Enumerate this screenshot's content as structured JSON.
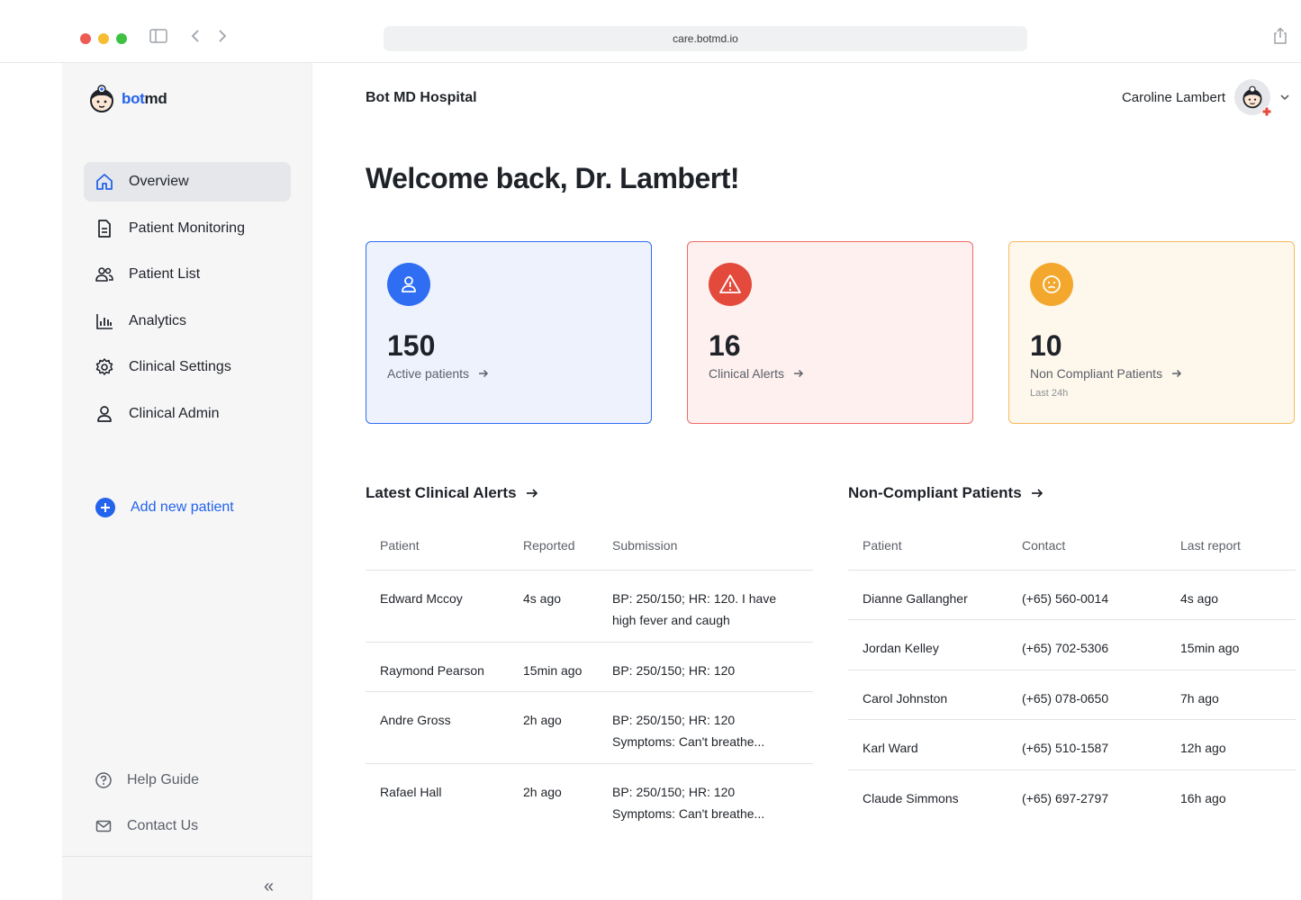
{
  "browser": {
    "url": "care.botmd.io"
  },
  "logo": {
    "part1": "bot",
    "part2": "md"
  },
  "sidebar": {
    "items": [
      {
        "label": "Overview",
        "icon": "home-icon",
        "active": true
      },
      {
        "label": "Patient Monitoring",
        "icon": "document-icon"
      },
      {
        "label": "Patient List",
        "icon": "users-icon"
      },
      {
        "label": "Analytics",
        "icon": "bar-chart-icon"
      },
      {
        "label": "Clinical Settings",
        "icon": "gear-icon"
      },
      {
        "label": "Clinical Admin",
        "icon": "user-icon"
      }
    ],
    "add_patient": "Add new patient",
    "help": "Help Guide",
    "contact": "Contact Us",
    "collapse": "«"
  },
  "header": {
    "hospital": "Bot MD Hospital",
    "user_name": "Caroline Lambert"
  },
  "welcome": "Welcome back, Dr. Lambert!",
  "cards": [
    {
      "value": "150",
      "label": "Active patients",
      "icon": "user-icon",
      "color": "#2f6ef3"
    },
    {
      "value": "16",
      "label": "Clinical Alerts",
      "icon": "warning-icon",
      "color": "#e34a3c"
    },
    {
      "value": "10",
      "label": "Non Compliant Patients",
      "sub": "Last 24h",
      "icon": "sad-face-icon",
      "color": "#f3a82d"
    }
  ],
  "alerts": {
    "title": "Latest Clinical Alerts",
    "headers": [
      "Patient",
      "Reported",
      "Submission"
    ],
    "rows": [
      {
        "patient": "Edward Mccoy",
        "reported": "4s ago",
        "sub1": "BP: 250/150; HR: 120. I have",
        "sub2": "high fever and caugh"
      },
      {
        "patient": "Raymond Pearson",
        "reported": "15min ago",
        "sub1": "BP: 250/150; HR: 120",
        "sub2": ""
      },
      {
        "patient": "Andre Gross",
        "reported": "2h ago",
        "sub1": "BP: 250/150; HR: 120",
        "sub2": "Symptoms: Can't breathe..."
      },
      {
        "patient": "Rafael Hall",
        "reported": "2h ago",
        "sub1": "BP: 250/150; HR: 120",
        "sub2": "Symptoms: Can't breathe..."
      }
    ]
  },
  "noncompliant": {
    "title": "Non-Compliant Patients",
    "headers": [
      "Patient",
      "Contact",
      "Last report"
    ],
    "rows": [
      {
        "patient": "Dianne Gallangher",
        "contact": "(+65) 560-0014",
        "last": "4s ago"
      },
      {
        "patient": "Jordan Kelley",
        "contact": "(+65) 702-5306",
        "last": "15min ago"
      },
      {
        "patient": "Carol Johnston",
        "contact": "(+65) 078-0650",
        "last": "7h ago"
      },
      {
        "patient": "Karl Ward",
        "contact": "(+65) 510-1587",
        "last": "12h ago"
      },
      {
        "patient": "Claude Simmons",
        "contact": "(+65) 697-2797",
        "last": "16h ago"
      }
    ]
  }
}
